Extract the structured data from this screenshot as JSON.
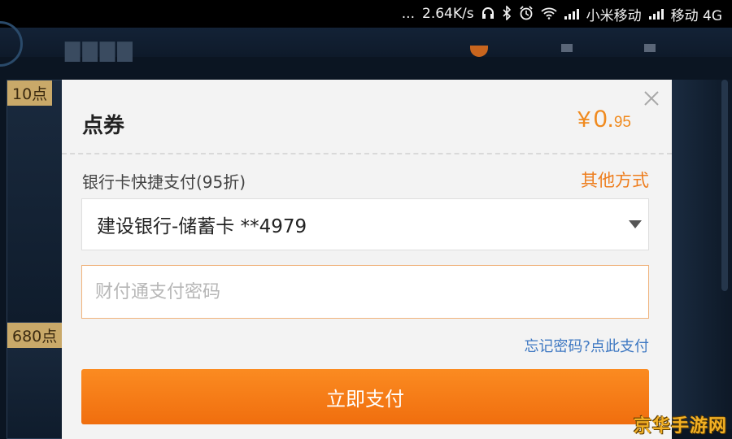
{
  "status_bar": {
    "dots": "...",
    "net_speed": "2.64K/s",
    "carrier1": "小米移动",
    "carrier2": "移动",
    "network_type": "4G",
    "icons": [
      "headphones-icon",
      "bluetooth-icon",
      "alarm-icon",
      "wifi-icon",
      "signal-icon",
      "signal-icon"
    ]
  },
  "background": {
    "tiles": [
      {
        "label": "10点"
      },
      {
        "label": "680点"
      }
    ]
  },
  "dialog": {
    "title": "点券",
    "price_currency": "¥",
    "price_integer": "0.",
    "price_decimal": "95",
    "payment_method_label": "银行卡快捷支付(95折)",
    "other_methods_link": "其他方式",
    "selected_card": "建设银行-储蓄卡 **4979",
    "password_placeholder": "财付通支付密码",
    "forgot_password_link": "忘记密码?点此支付",
    "pay_button_label": "立即支付"
  },
  "watermark": "京华手游网",
  "colors": {
    "accent_orange": "#f08a1e",
    "link_blue": "#3e78c2",
    "pay_button": "#f57a15"
  }
}
